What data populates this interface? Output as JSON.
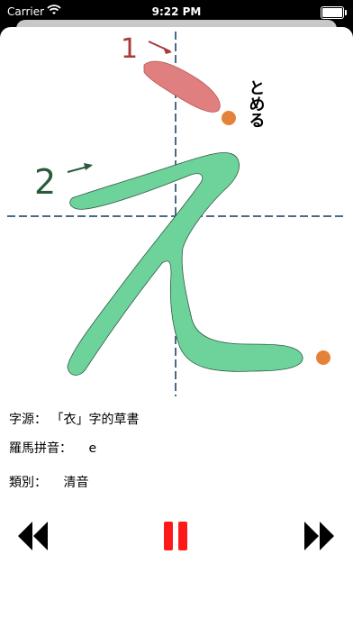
{
  "status_bar": {
    "carrier": "Carrier",
    "time": "9:22 PM"
  },
  "character": {
    "stroke_numbers": [
      "1",
      "2"
    ],
    "stroke_note": "とめる"
  },
  "info": {
    "origin_label": "字源：",
    "origin_value": "「衣」字的草書",
    "romaji_label": "羅馬拼音：",
    "romaji_value": "e",
    "type_label": "類別：",
    "type_value": "清音"
  },
  "colors": {
    "stroke1_fill": "#e07f7f",
    "stroke2_fill": "#6ed39a",
    "end_dot": "#e5823a",
    "guide_line": "#4a6a87",
    "pause_red": "#ff1a1a",
    "number_1": "#a83a3a",
    "number_2": "#2a5a3a"
  },
  "icons": {
    "rewind": "rewind-icon",
    "pause": "pause-icon",
    "forward": "fast-forward-icon"
  }
}
